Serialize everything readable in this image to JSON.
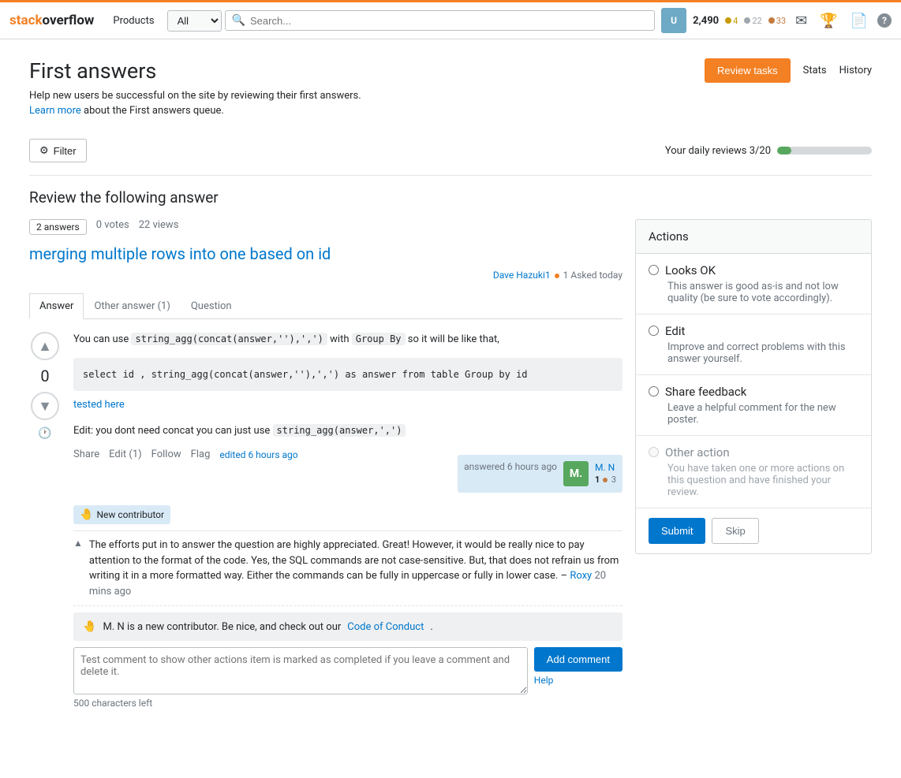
{
  "topbar": {
    "logo_stack": "stack",
    "logo_overflow": "overflow",
    "products_label": "Products",
    "search_placeholder": "Search...",
    "search_select_default": "All",
    "user_rep": "2,490",
    "badge_gold_count": "4",
    "badge_silver_count": "22",
    "badge_bronze_count": "33"
  },
  "page": {
    "title": "First answers",
    "desc1": "Help new users be successful on the site by reviewing their first answers.",
    "learn_more": "Learn more",
    "desc2": "about the First answers queue.",
    "review_tasks_label": "Review tasks",
    "stats_label": "Stats",
    "history_label": "History"
  },
  "filter": {
    "filter_label": "Filter",
    "daily_reviews_label": "Your daily reviews 3/20",
    "progress_percent": 15
  },
  "review": {
    "heading": "Review the following answer",
    "answers_badge": "2 answers",
    "votes": "0 votes",
    "views": "22 views",
    "question_link": "merging multiple rows into one based on id",
    "author_name": "Dave Hazuki1",
    "author_badge": "1",
    "asked_when": "Asked today",
    "tabs": {
      "answer": "Answer",
      "other_answer": "Other answer (1)",
      "question": "Question"
    },
    "answer": {
      "vote_count": "0",
      "text_before_code1": "You can use ",
      "inline_code1": "string_agg(concat(answer,''),',')",
      "text_mid1": " with ",
      "inline_code2": "Group By",
      "text_mid2": " so it will be like that,",
      "code_block": "select id , string_agg(concat(answer,''),',') as answer from table Group by id",
      "tested_here_link": "tested here",
      "edit_text1": "Edit: you dont need concat you can just use ",
      "inline_code3": "string_agg(answer,',')",
      "share_label": "Share",
      "edit_label": "Edit (1)",
      "follow_label": "Follow",
      "flag_label": "Flag",
      "edited_when": "edited 6 hours ago",
      "answered_when": "answered 6 hours ago",
      "answerer_initial": "M.",
      "answerer_name": "M. N",
      "answerer_rep": "1",
      "answerer_badge_bronze": "3",
      "new_contributor_label": "New contributor"
    },
    "comment": {
      "text": "The efforts put in to answer the question are highly appreciated. Great! However, it would be really nice to pay attention to the format of the code. Yes, the SQL commands are not case-sensitive. But, that does not refrain us from writing it in a more formatted way. Either the commands can be fully in uppercase or fully in lower case. –",
      "author": "Roxy",
      "time": "20 mins ago"
    },
    "new_contributor_notice": {
      "hand_emoji": "🤚",
      "text_before_link": "M. N is a new contributor. Be nice, and check out our",
      "link_text": "Code of Conduct",
      "text_after": "."
    },
    "comment_box": {
      "placeholder_text": "Test comment to show other actions item is marked as completed if you leave a comment and delete it.",
      "help_label": "Help",
      "chars_left": "500 characters left"
    },
    "add_comment_btn": "Add comment"
  },
  "actions": {
    "header": "Actions",
    "options": [
      {
        "id": "looks-ok",
        "label": "Looks OK",
        "desc": "This answer is good as-is and not low quality (be sure to vote accordingly).",
        "disabled": false
      },
      {
        "id": "edit",
        "label": "Edit",
        "desc": "Improve and correct problems with this answer yourself.",
        "disabled": false
      },
      {
        "id": "share-feedback",
        "label": "Share feedback",
        "desc": "Leave a helpful comment for the new poster.",
        "disabled": false
      },
      {
        "id": "other-action",
        "label": "Other action",
        "desc": "You have taken one or more actions on this question and have finished your review.",
        "disabled": true
      }
    ],
    "submit_label": "Submit",
    "skip_label": "Skip"
  }
}
